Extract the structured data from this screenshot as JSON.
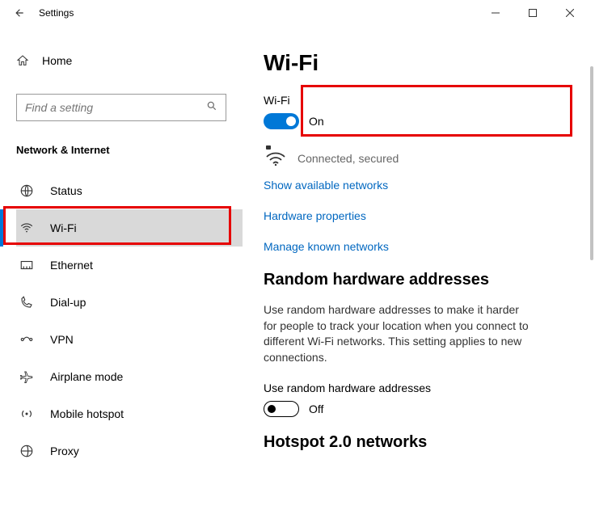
{
  "window": {
    "title": "Settings"
  },
  "home": {
    "label": "Home"
  },
  "search": {
    "placeholder": "Find a setting"
  },
  "section_title": "Network & Internet",
  "nav": {
    "status": {
      "label": "Status"
    },
    "wifi": {
      "label": "Wi-Fi"
    },
    "ethernet": {
      "label": "Ethernet"
    },
    "dialup": {
      "label": "Dial-up"
    },
    "vpn": {
      "label": "VPN"
    },
    "airplane": {
      "label": "Airplane mode"
    },
    "hotspot": {
      "label": "Mobile hotspot"
    },
    "proxy": {
      "label": "Proxy"
    }
  },
  "page": {
    "title": "Wi-Fi",
    "wifi_label": "Wi-Fi",
    "wifi_toggle_state": "On",
    "connection_status": "Connected, secured",
    "links": {
      "show_networks": "Show available networks",
      "hardware_props": "Hardware properties",
      "manage_known": "Manage known networks"
    },
    "random_hw": {
      "heading": "Random hardware addresses",
      "desc": "Use random hardware addresses to make it harder for people to track your location when you connect to different Wi-Fi networks. This setting applies to new connections.",
      "toggle_label": "Use random hardware addresses",
      "toggle_state": "Off"
    },
    "hotspot2": {
      "heading": "Hotspot 2.0 networks"
    }
  }
}
